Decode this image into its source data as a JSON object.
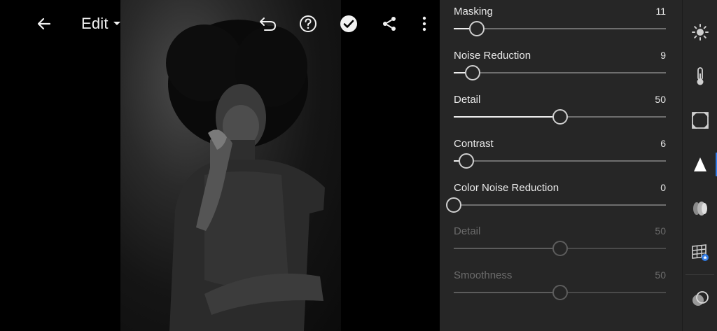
{
  "topbar": {
    "back_icon": "arrow-left-icon",
    "edit_label": "Edit",
    "edit_dropdown_icon": "caret-down-icon",
    "undo_icon": "undo-icon",
    "help_icon": "help-circle-icon",
    "done_icon": "check-circle-icon",
    "share_icon": "share-icon",
    "more_icon": "more-vertical-icon"
  },
  "panel": {
    "sliders": [
      {
        "label": "Masking",
        "value": "11",
        "position": 0.11,
        "disabled": false
      },
      {
        "label": "Noise Reduction",
        "value": "9",
        "position": 0.09,
        "disabled": false
      },
      {
        "label": "Detail",
        "value": "50",
        "position": 0.5,
        "disabled": false
      },
      {
        "label": "Contrast",
        "value": "6",
        "position": 0.06,
        "disabled": false
      },
      {
        "label": "Color Noise Reduction",
        "value": "0",
        "position": 0.0,
        "disabled": false
      },
      {
        "label": "Detail",
        "value": "50",
        "position": 0.5,
        "disabled": true
      },
      {
        "label": "Smoothness",
        "value": "50",
        "position": 0.5,
        "disabled": true
      }
    ]
  },
  "toolstrip": {
    "tools": [
      {
        "icon": "light-icon",
        "active": false
      },
      {
        "icon": "color-temperature-icon",
        "active": false
      },
      {
        "icon": "effects-icon",
        "active": false
      },
      {
        "icon": "detail-icon",
        "active": true
      },
      {
        "icon": "optics-icon",
        "active": false
      },
      {
        "icon": "geometry-icon",
        "active": false
      },
      {
        "icon": "presets-icon",
        "active": false
      }
    ]
  },
  "colors": {
    "accent": "#2f7ae5",
    "panel_bg": "#262626",
    "canvas_bg": "#000000"
  }
}
